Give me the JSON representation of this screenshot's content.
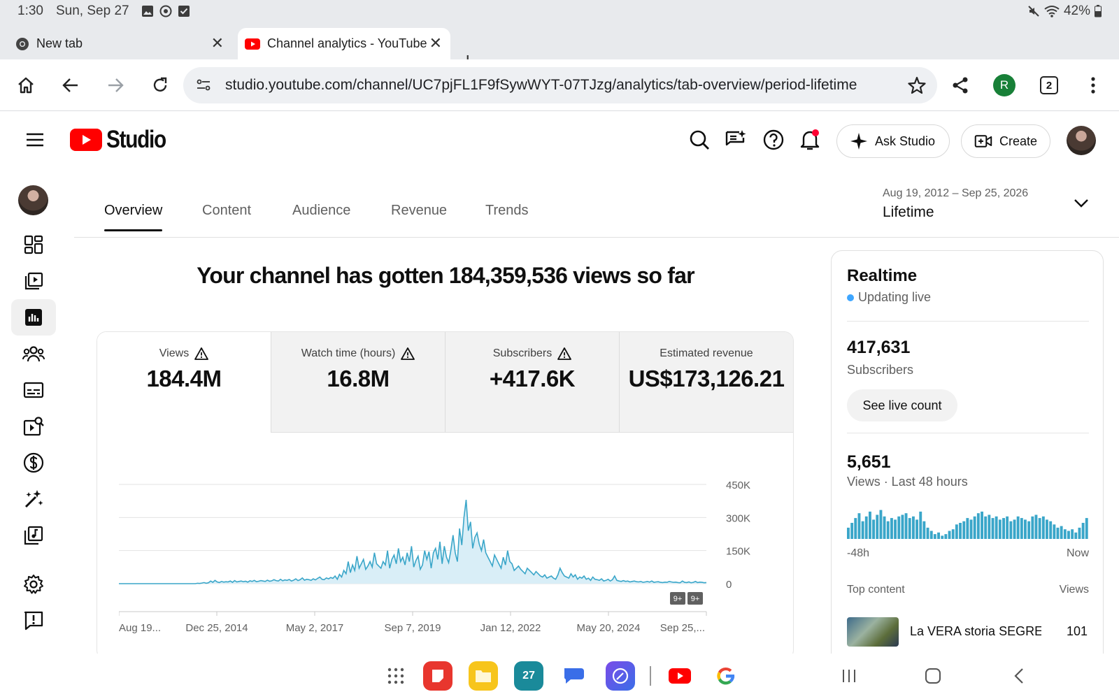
{
  "status_bar": {
    "time": "1:30",
    "date": "Sun, Sep 27",
    "battery": "42%"
  },
  "browser": {
    "tabs": [
      {
        "label": "New tab"
      },
      {
        "label": "Channel analytics - YouTube Studio"
      }
    ],
    "url": "studio.youtube.com/channel/UC7pjFL1F9fSywWYT-07TJzg/analytics/tab-overview/period-lifetime",
    "profile_initial": "R",
    "tab_count": "2"
  },
  "header": {
    "logo_text": "Studio",
    "ask_label": "Ask Studio",
    "create_label": "Create"
  },
  "analytics": {
    "tabs": [
      "Overview",
      "Content",
      "Audience",
      "Revenue",
      "Trends"
    ],
    "date_range": {
      "dates": "Aug 19, 2012 – Sep 25, 2026",
      "label": "Lifetime"
    },
    "headline": "Your channel has gotten 184,359,536 views so far",
    "metrics": [
      {
        "label": "Views",
        "value": "184.4M"
      },
      {
        "label": "Watch time (hours)",
        "value": "16.8M"
      },
      {
        "label": "Subscribers",
        "value": "+417.6K"
      },
      {
        "label": "Estimated revenue",
        "value": "US$173,126.21"
      }
    ]
  },
  "chart_data": {
    "type": "area",
    "x_tick_labels": [
      "Aug 19...",
      "Dec 25, 2014",
      "May 2, 2017",
      "Sep 7, 2019",
      "Jan 12, 2022",
      "May 20, 2024",
      "Sep 25,..."
    ],
    "y_tick_labels": [
      "450K",
      "300K",
      "150K",
      "0"
    ],
    "ylim": [
      0,
      450000
    ],
    "series": [
      {
        "values": [
          0,
          0,
          0,
          0,
          0,
          0,
          0,
          0,
          0,
          0,
          0,
          0,
          0,
          0,
          0,
          0,
          0,
          0,
          0,
          0,
          0,
          0,
          0,
          0,
          0,
          0,
          0,
          0,
          0,
          0,
          0,
          0,
          0,
          0,
          0,
          0,
          2000,
          1000,
          3000,
          5000,
          2000,
          4000,
          12000,
          6000,
          15000,
          8000,
          5000,
          10000,
          7000,
          9000,
          8000,
          12000,
          6000,
          14000,
          8000,
          10000,
          12000,
          9000,
          11000,
          7000,
          13000,
          10000,
          15000,
          9000,
          11000,
          14000,
          12000,
          10000,
          16000,
          11000,
          13000,
          18000,
          14000,
          12000,
          20000,
          13000,
          17000,
          15000,
          19000,
          12000,
          16000,
          22000,
          14000,
          18000,
          26000,
          16000,
          20000,
          18000,
          15000,
          22000,
          17000,
          24000,
          30000,
          20000,
          18000,
          26000,
          22000,
          28000,
          24000,
          35000,
          20000,
          42000,
          30000,
          60000,
          45000,
          100000,
          50000,
          85000,
          60000,
          125000,
          70000,
          90000,
          110000,
          65000,
          80000,
          100000,
          75000,
          140000,
          90000,
          80000,
          70000,
          100000,
          85000,
          150000,
          70000,
          110000,
          130000,
          90000,
          160000,
          100000,
          120000,
          85000,
          140000,
          100000,
          170000,
          75000,
          105000,
          125000,
          65000,
          85000,
          150000,
          110000,
          145000,
          70000,
          140000,
          160000,
          110000,
          190000,
          90000,
          170000,
          120000,
          95000,
          150000,
          220000,
          140000,
          100000,
          250000,
          175000,
          300000,
          380000,
          240000,
          280000,
          160000,
          210000,
          230000,
          180000,
          150000,
          200000,
          140000,
          120000,
          100000,
          80000,
          130000,
          110000,
          90000,
          70000,
          120000,
          85000,
          150000,
          100000,
          90000,
          60000,
          70000,
          80000,
          65000,
          55000,
          45000,
          70000,
          60000,
          50000,
          40000,
          55000,
          45000,
          35000,
          30000,
          40000,
          25000,
          30000,
          35000,
          25000,
          20000,
          40000,
          70000,
          50000,
          35000,
          30000,
          25000,
          45000,
          30000,
          40000,
          20000,
          30000,
          25000,
          35000,
          20000,
          25000,
          15000,
          30000,
          20000,
          18000,
          15000,
          22000,
          12000,
          15000,
          20000,
          12000,
          18000,
          35000,
          15000,
          12000,
          10000,
          14000,
          10000,
          12000,
          8000,
          10000,
          12000,
          9000,
          8000,
          10000,
          6000,
          8000,
          10000,
          7000,
          12000,
          6000,
          8000,
          9000,
          6000,
          5000,
          7000,
          6000,
          10000,
          8000,
          6000,
          7000,
          5000,
          4000,
          12000,
          6000,
          5000,
          8000,
          4000,
          6000,
          10000,
          5000,
          7000,
          6000,
          4000,
          5000
        ]
      }
    ]
  },
  "realtime": {
    "title": "Realtime",
    "status": "Updating live",
    "subscribers_value": "417,631",
    "subscribers_label": "Subscribers",
    "live_button": "See live count",
    "views_value": "5,651",
    "views_label": "Views · Last 48 hours",
    "bars": [
      0.35,
      0.5,
      0.65,
      0.8,
      0.55,
      0.7,
      0.85,
      0.6,
      0.75,
      0.9,
      0.7,
      0.55,
      0.65,
      0.6,
      0.7,
      0.75,
      0.8,
      0.65,
      0.7,
      0.6,
      0.85,
      0.55,
      0.35,
      0.25,
      0.15,
      0.2,
      0.1,
      0.15,
      0.25,
      0.3,
      0.45,
      0.5,
      0.55,
      0.65,
      0.6,
      0.7,
      0.8,
      0.85,
      0.7,
      0.75,
      0.65,
      0.7,
      0.6,
      0.65,
      0.7,
      0.55,
      0.6,
      0.7,
      0.65,
      0.6,
      0.55,
      0.7,
      0.75,
      0.65,
      0.7,
      0.6,
      0.55,
      0.45,
      0.35,
      0.4,
      0.3,
      0.25,
      0.3,
      0.2,
      0.35,
      0.5,
      0.65
    ],
    "bars_from": "-48h",
    "bars_to": "Now",
    "top_content_label": "Top content",
    "top_content_views_label": "Views",
    "top_video_title": "La VERA storia SEGRETA",
    "top_video_views": "101"
  }
}
